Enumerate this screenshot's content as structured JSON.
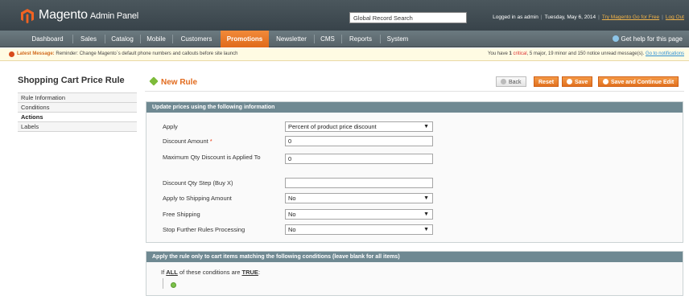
{
  "header": {
    "logo_text": "Magento",
    "logo_sub": "Admin Panel",
    "search_value": "Global Record Search",
    "logged_in": "Logged in as admin",
    "date": "Tuesday, May 6, 2014",
    "try_link": "Try Magento Go for Free",
    "logout": "Log Out"
  },
  "nav": {
    "items": [
      "Dashboard",
      "Sales",
      "Catalog",
      "Mobile",
      "Customers",
      "Promotions",
      "Newsletter",
      "CMS",
      "Reports",
      "System"
    ],
    "active": "Promotions",
    "help": "Get help for this page"
  },
  "message": {
    "title": "Latest Message:",
    "text": "Reminder: Change Magento`s default phone numbers and callouts before site launch",
    "right_prefix": "You have",
    "critical_count": "1",
    "critical_label": "critical",
    "rest": ", 5 major, 19 minor and 150 notice unread message(s).",
    "link": "Go to notifications"
  },
  "sidebar": {
    "title": "Shopping Cart Price Rule",
    "items": [
      "Rule Information",
      "Conditions",
      "Actions",
      "Labels"
    ]
  },
  "page": {
    "title": "New Rule",
    "buttons": {
      "back": "Back",
      "reset": "Reset",
      "save": "Save",
      "save_continue": "Save and Continue Edit"
    }
  },
  "actions_form": {
    "header": "Update prices using the following information",
    "fields": [
      {
        "label": "Apply",
        "value": "Percent of product price discount",
        "type": "select"
      },
      {
        "label": "Discount Amount",
        "required": "*",
        "value": "0",
        "type": "input"
      },
      {
        "label": "Maximum Qty Discount is Applied To",
        "value": "0",
        "type": "input"
      },
      {
        "label": "Discount Qty Step (Buy X)",
        "value": "",
        "type": "input"
      },
      {
        "label": "Apply to Shipping Amount",
        "value": "No",
        "type": "select"
      },
      {
        "label": "Free Shipping",
        "value": "No",
        "type": "select"
      },
      {
        "label": "Stop Further Rules Processing",
        "value": "No",
        "type": "select"
      }
    ]
  },
  "conditions": {
    "header": "Apply the rule only to cart items matching the following conditions (leave blank for all items)",
    "prefix": "If",
    "aggregator": "ALL",
    "middle": "of these conditions are",
    "value": "TRUE",
    "suffix": ":"
  },
  "colors": {
    "accent": "#e26b1e",
    "nav_active": "#e97b2a",
    "section_head": "#6f8992"
  }
}
